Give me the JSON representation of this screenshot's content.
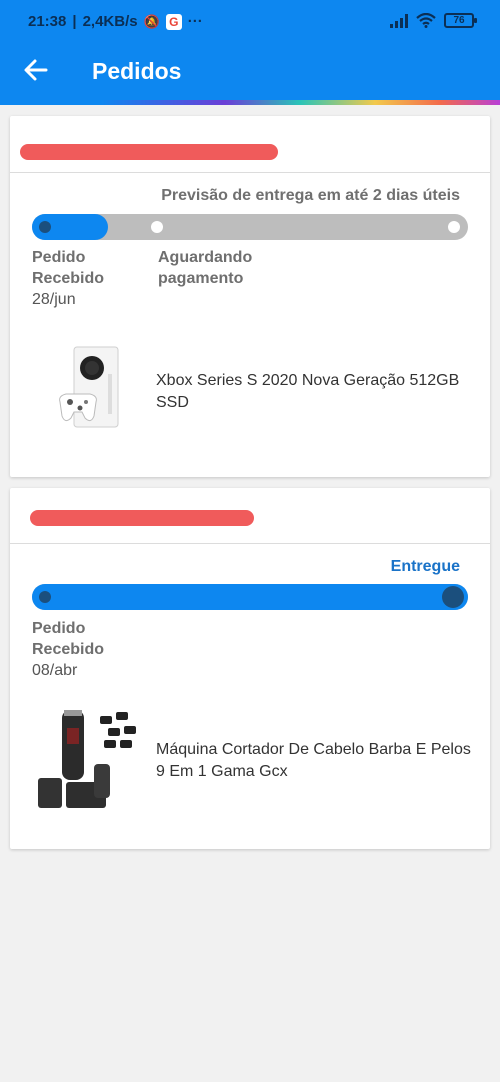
{
  "status_bar": {
    "time": "21:38",
    "speed": "2,4KB/s",
    "dots": "···",
    "battery": "76"
  },
  "app_bar": {
    "title": "Pedidos"
  },
  "orders": [
    {
      "status": "Previsão de entrega em até 2 dias úteis",
      "progress": 0.17,
      "steps": [
        {
          "label": "Pedido Recebido",
          "date": "28/jun"
        },
        {
          "label": "Aguardando pagamento",
          "date": ""
        }
      ],
      "product_name": "Xbox Series S 2020 Nova Geração 512GB SSD"
    },
    {
      "status": "Entregue",
      "progress": 1.0,
      "steps": [
        {
          "label": "Pedido Recebido",
          "date": "08/abr"
        }
      ],
      "product_name": "Máquina Cortador De Cabelo Barba E Pelos 9 Em 1 Gama Gcx"
    }
  ],
  "colors": {
    "primary": "#0d87f0",
    "track": "#bdbdbd",
    "delivered_text": "#1a73c8",
    "redaction": "#f05b5b"
  }
}
